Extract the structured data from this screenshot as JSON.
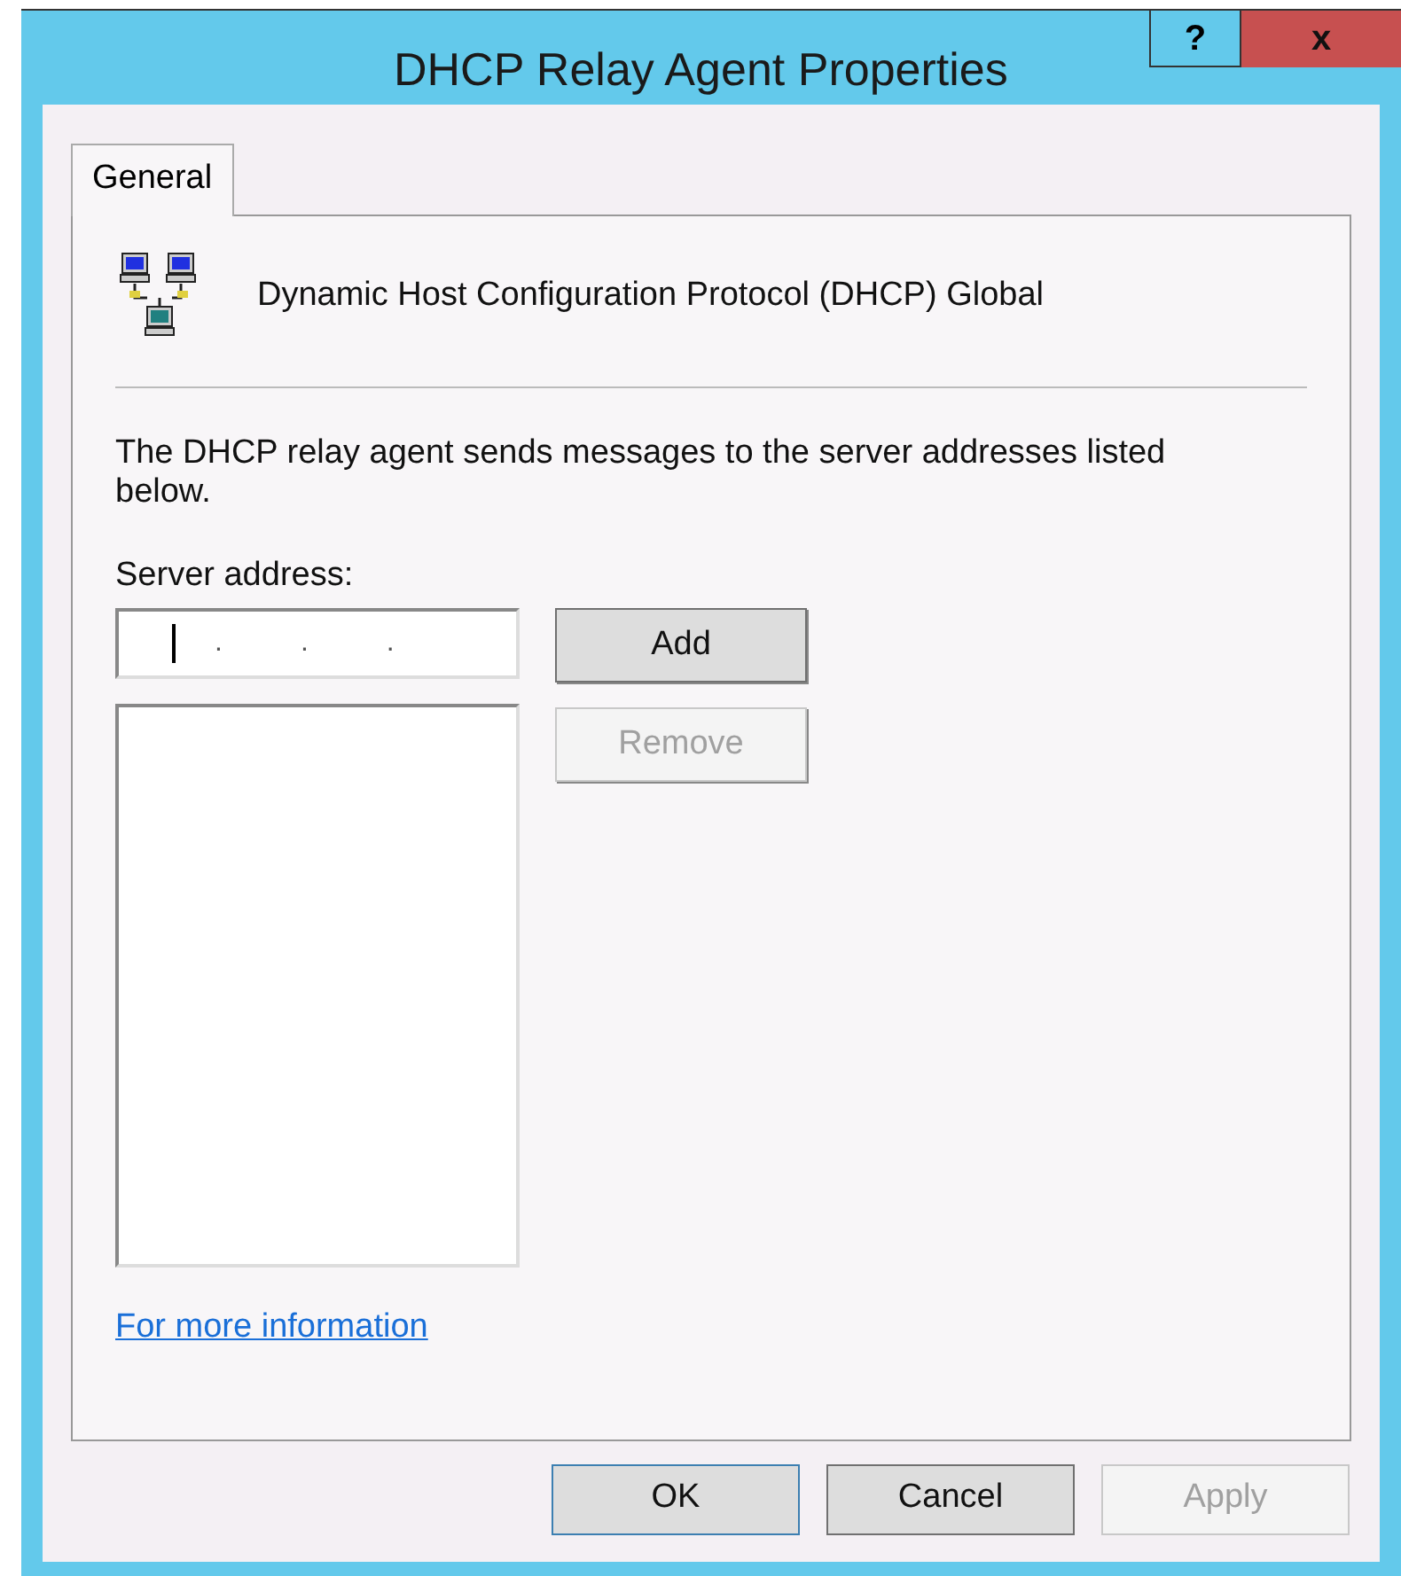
{
  "window": {
    "title": "DHCP Relay Agent Properties",
    "help_label": "?",
    "close_label": "x"
  },
  "tabs": [
    {
      "label": "General",
      "selected": true
    }
  ],
  "header": {
    "text": "Dynamic Host Configuration Protocol (DHCP) Global"
  },
  "description": "The DHCP relay agent sends messages to the server addresses listed below.",
  "server_address": {
    "label": "Server address:",
    "separators": [
      ".",
      ".",
      "."
    ],
    "focused": true
  },
  "side_buttons": [
    {
      "label": "Add",
      "disabled": false
    },
    {
      "label": "Remove",
      "disabled": true
    }
  ],
  "link": "For more information",
  "buttons": [
    {
      "label": "OK",
      "disabled": false,
      "default": true
    },
    {
      "label": "Cancel",
      "disabled": false,
      "default": false
    },
    {
      "label": "Apply",
      "disabled": true,
      "default": false
    }
  ]
}
